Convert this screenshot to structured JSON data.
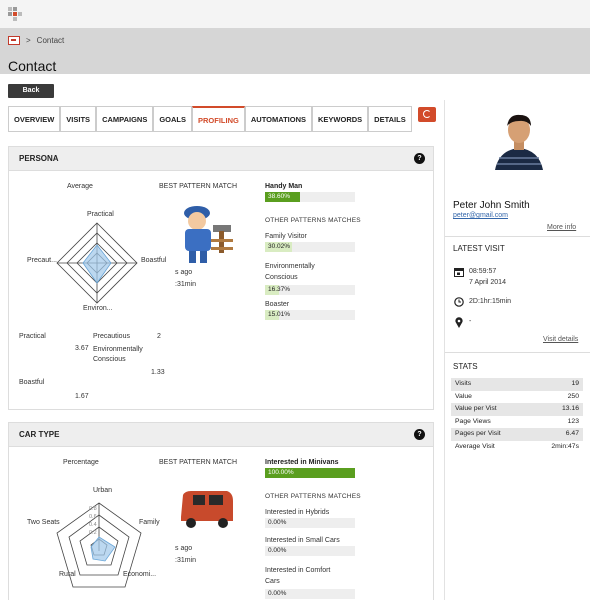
{
  "breadcrumb": {
    "separator": ">",
    "current": "Contact"
  },
  "page": {
    "title": "Contact",
    "back_label": "Back"
  },
  "tabs": [
    "OVERVIEW",
    "VISITS",
    "CAMPAIGNS",
    "GOALS",
    "PROFILING",
    "AUTOMATIONS",
    "KEYWORDS",
    "DETAILS"
  ],
  "active_tab": "PROFILING",
  "accent": "#d24b2a",
  "persona": {
    "title": "PERSONA",
    "chart_title": "Average",
    "axes": [
      "Practical",
      "Boastful",
      "Environ...",
      "Precaut..."
    ],
    "values": [
      3,
      2,
      3,
      2
    ],
    "best_label": "BEST PATTERN MATCH",
    "partial_a": "s ago",
    "partial_b": ":31min",
    "top_match": {
      "name": "Handy Man",
      "pct": "38.60%",
      "value": 38.6
    },
    "other_label": "OTHER PATTERNS MATCHES",
    "others": [
      {
        "name": "Family Visitor",
        "pct": "30.02%",
        "value": 30.02
      },
      {
        "name": "Environmentally Conscious",
        "pct": "16.37%",
        "value": 16.37
      },
      {
        "name": "Boaster",
        "pct": "15.01%",
        "value": 15.01
      }
    ],
    "table": {
      "practical": "Practical",
      "precautious": "Precautious",
      "two": "2",
      "v367": "3.67",
      "environ": "Environmentally Conscious",
      "v133": "1.33",
      "boastful": "Boastful",
      "v167": "1.67"
    }
  },
  "car": {
    "title": "CAR TYPE",
    "chart_title": "Percentage",
    "axes": [
      "Urban",
      "Family",
      "Economi...",
      "Rural",
      "Two Seats"
    ],
    "ticks": [
      "0.8",
      "0.6",
      "0.4",
      "0.2"
    ],
    "best_label": "BEST PATTERN MATCH",
    "partial_a": "s ago",
    "partial_b": ":31min",
    "top_match": {
      "name": "Interested in Minivans",
      "pct": "100.00%",
      "value": 100
    },
    "other_label": "OTHER PATTERNS MATCHES",
    "others": [
      {
        "name": "Interested in Hybrids",
        "pct": "0.00%",
        "value": 0
      },
      {
        "name": "Interested in Small Cars",
        "pct": "0.00%",
        "value": 0
      },
      {
        "name": "Interested in Comfort Cars",
        "pct": "0.00%",
        "value": 0
      }
    ]
  },
  "contact": {
    "name": "Peter John Smith",
    "email": "peter@gmail.com",
    "more_info": "More info"
  },
  "latest_visit": {
    "title": "LATEST VISIT",
    "time": "08:59:57",
    "date": "7 April 2014",
    "duration": "2D:1hr:15min",
    "location": "-",
    "details": "Visit details"
  },
  "stats": {
    "title": "STATS",
    "rows": [
      {
        "label": "Visits",
        "value": "19"
      },
      {
        "label": "Value",
        "value": "250"
      },
      {
        "label": "Value per Vist",
        "value": "13.16"
      },
      {
        "label": "Page Views",
        "value": "123"
      },
      {
        "label": "Pages per Visit",
        "value": "6.47"
      },
      {
        "label": "Average Visit",
        "value": "2min:47s"
      }
    ]
  }
}
